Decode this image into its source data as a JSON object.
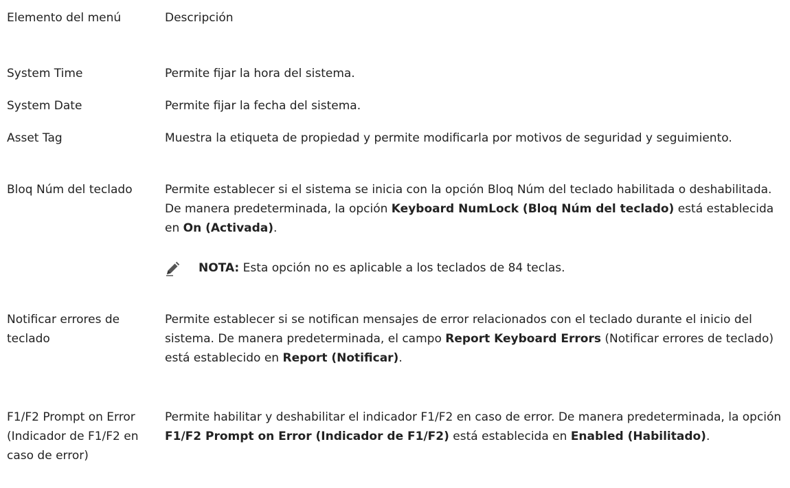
{
  "header": {
    "col1": "Elemento del menú",
    "col2": "Descripción"
  },
  "rows": [
    {
      "term": "System Time",
      "description": "Permite fijar la hora del sistema."
    },
    {
      "term": "System Date",
      "description": "Permite fijar la fecha del sistema."
    },
    {
      "term": "Asset Tag",
      "description": "Muestra la etiqueta de propiedad y permite modificarla por motivos de seguridad y seguimiento."
    },
    {
      "term": "Bloq Núm del teclado",
      "description": {
        "t1": "Permite establecer si el sistema se inicia con la opción Bloq Núm del teclado habilitada o deshabilitada. De manera predeterminada, la opción ",
        "b1": "Keyboard NumLock (Bloq Núm del teclado)",
        "t2": " está establecida en ",
        "b2": "On (Activada)",
        "t3": "."
      },
      "note": {
        "icon": "pencil-icon",
        "label": "NOTA:",
        "text": " Esta opción no es aplicable a los teclados de 84 teclas."
      }
    },
    {
      "term": "Notificar errores de teclado",
      "description": {
        "t1": "Permite establecer si se notifican mensajes de error relacionados con el teclado durante el inicio del sistema. De manera predeterminada, el campo ",
        "b1": "Report Keyboard Errors",
        "t2": " (Notificar errores de teclado) está establecido en ",
        "b2": "Report (Notificar)",
        "t3": "."
      }
    },
    {
      "term": "F1/F2 Prompt on Error (Indicador de F1/F2 en caso de error)",
      "description": {
        "t1": "Permite habilitar y deshabilitar el indicador F1/F2 en caso de error. De manera predeterminada, la opción ",
        "b1": "F1/F2 Prompt on Error (Indicador de F1/F2)",
        "t2": " está establecida en ",
        "b2": "Enabled (Habilitado)",
        "t3": "."
      }
    }
  ]
}
